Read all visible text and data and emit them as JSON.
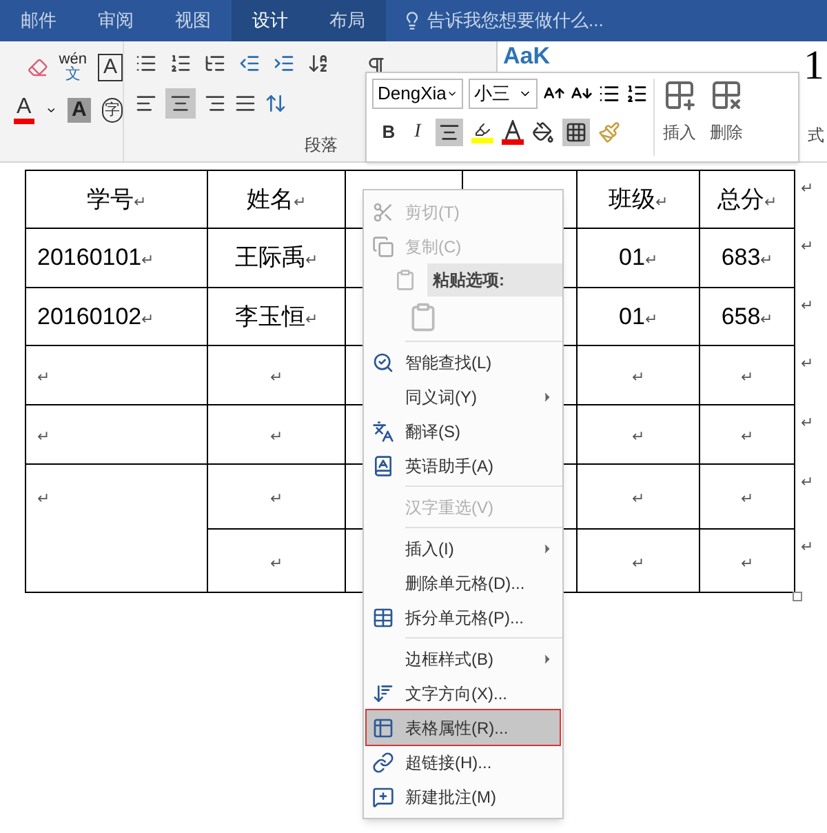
{
  "tabs": [
    {
      "label": "邮件",
      "selected": false,
      "contextual": false
    },
    {
      "label": "审阅",
      "selected": false,
      "contextual": false
    },
    {
      "label": "视图",
      "selected": false,
      "contextual": false
    },
    {
      "label": "设计",
      "selected": true,
      "contextual": true
    },
    {
      "label": "布局",
      "selected": false,
      "contextual": true
    }
  ],
  "tell_me": {
    "placeholder": "告诉我您想要做什么..."
  },
  "ribbon": {
    "font_glyphs": [
      {
        "kind": "phonetic",
        "text": "wén",
        "sub": "文"
      },
      {
        "kind": "border",
        "text": "A"
      },
      {
        "kind": "color",
        "text": "A"
      },
      {
        "kind": "shading",
        "text": "A"
      },
      {
        "kind": "enclose",
        "text": "字"
      }
    ],
    "paragraph_group": "段落",
    "style_preview": "AaK",
    "heading_preview": "1",
    "styles_label": "式"
  },
  "mini_toolbar": {
    "font": "DengXia",
    "size": "小三",
    "insert": "插入",
    "delete": "删除",
    "bold": "B",
    "italic": "I",
    "center_selected": true,
    "borders_selected": true
  },
  "table": {
    "rows": [
      {
        "cells": [
          {
            "text": "学号",
            "mark": "↵"
          },
          {
            "text": "姓名",
            "mark": "↵"
          },
          {},
          {},
          {
            "text": "班级",
            "mark": "↵"
          },
          {
            "text": "总分",
            "mark": "↵"
          }
        ],
        "end": "↵"
      },
      {
        "cells": [
          {
            "text": "20160101",
            "mark": "↵"
          },
          {
            "text": "王际禹",
            "mark": "↵"
          },
          {},
          {},
          {
            "text": "01",
            "mark": "↵"
          },
          {
            "text": "683",
            "mark": "↵"
          }
        ],
        "end": "↵"
      },
      {
        "cells": [
          {
            "text": "20160102",
            "mark": "↵"
          },
          {
            "text": "李玉恒",
            "mark": "↵"
          },
          {},
          {},
          {
            "text": "01",
            "mark": "↵"
          },
          {
            "text": "658",
            "mark": "↵"
          }
        ],
        "end": "↵"
      },
      {
        "cells": [
          {
            "mark": "↵"
          },
          {
            "mark": "↵"
          },
          {},
          {},
          {
            "mark": "↵"
          },
          {
            "mark": "↵"
          }
        ],
        "end": "↵"
      },
      {
        "cells": [
          {
            "mark": "↵"
          },
          {
            "mark": "↵"
          },
          {},
          {},
          {
            "mark": "↵"
          },
          {
            "mark": "↵"
          }
        ],
        "end": "↵"
      },
      {
        "cells": [
          {
            "mark": "↵",
            "rowspan": 2
          },
          {
            "mark": "↵"
          },
          {},
          {},
          {
            "mark": "↵"
          },
          {
            "mark": "↵"
          }
        ],
        "end": "↵"
      },
      {
        "cells": [
          {
            "mark": "↵"
          },
          {},
          {},
          {
            "mark": "↵"
          },
          {
            "mark": "↵"
          }
        ],
        "end": "↵"
      }
    ]
  },
  "context_menu": [
    {
      "kind": "item",
      "label": "剪切(T)",
      "disabled": true,
      "selected": false,
      "submenu": false
    },
    {
      "kind": "item",
      "label": "复制(C)",
      "disabled": true,
      "selected": false,
      "submenu": false
    },
    {
      "kind": "header",
      "label": "粘贴选项:"
    },
    {
      "kind": "paste"
    },
    {
      "kind": "separator"
    },
    {
      "kind": "item",
      "label": "智能查找(L)",
      "disabled": false,
      "selected": false,
      "submenu": false
    },
    {
      "kind": "item",
      "label": "同义词(Y)",
      "disabled": false,
      "selected": false,
      "submenu": true
    },
    {
      "kind": "item",
      "label": "翻译(S)",
      "disabled": false,
      "selected": false,
      "submenu": false
    },
    {
      "kind": "item",
      "label": "英语助手(A)",
      "disabled": false,
      "selected": false,
      "submenu": false
    },
    {
      "kind": "separator"
    },
    {
      "kind": "item",
      "label": "汉字重选(V)",
      "disabled": true,
      "selected": false,
      "submenu": false
    },
    {
      "kind": "separator"
    },
    {
      "kind": "item",
      "label": "插入(I)",
      "disabled": false,
      "selected": false,
      "submenu": true
    },
    {
      "kind": "item",
      "label": "删除单元格(D)...",
      "disabled": false,
      "selected": false,
      "submenu": false
    },
    {
      "kind": "item",
      "label": "拆分单元格(P)...",
      "disabled": false,
      "selected": false,
      "submenu": false
    },
    {
      "kind": "separator"
    },
    {
      "kind": "item",
      "label": "边框样式(B)",
      "disabled": false,
      "selected": false,
      "submenu": true
    },
    {
      "kind": "item",
      "label": "文字方向(X)...",
      "disabled": false,
      "selected": false,
      "submenu": false
    },
    {
      "kind": "item",
      "label": "表格属性(R)...",
      "disabled": false,
      "selected": true,
      "submenu": false
    },
    {
      "kind": "item",
      "label": "超链接(H)...",
      "disabled": false,
      "selected": false,
      "submenu": false
    },
    {
      "kind": "item",
      "label": "新建批注(M)",
      "disabled": false,
      "selected": false,
      "submenu": false
    }
  ]
}
